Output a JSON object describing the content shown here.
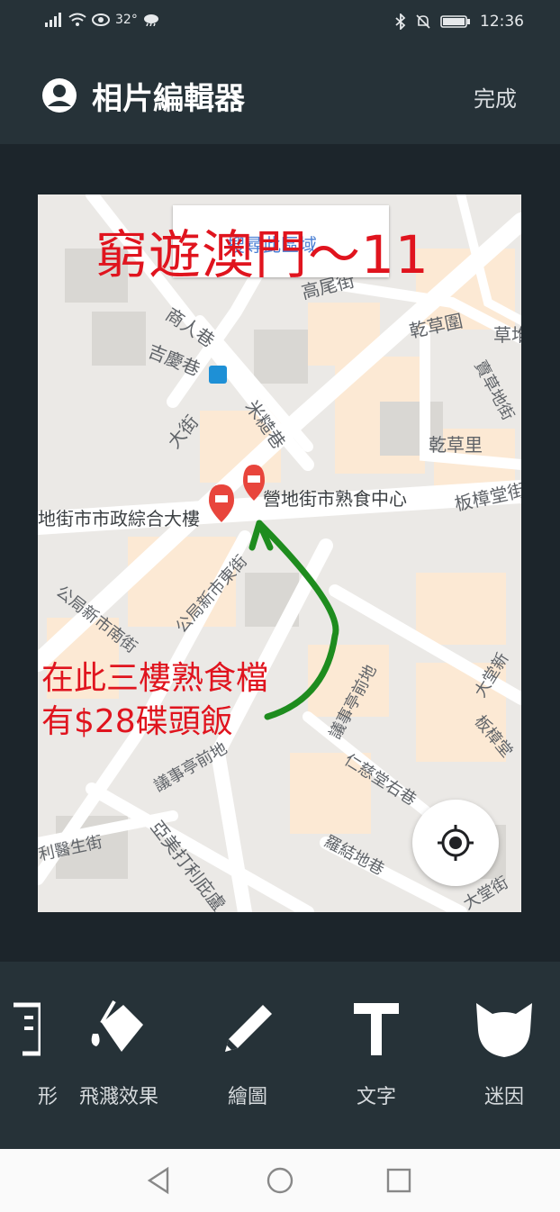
{
  "status_bar": {
    "temperature": "32°",
    "time": "12:36"
  },
  "header": {
    "title": "相片編輯器",
    "done_label": "完成"
  },
  "photo": {
    "headline": "窮遊澳門～11",
    "search_area_label": "搜尋此區域",
    "annotation_line1": "在此三樓熟食檔",
    "annotation_line2": "有$28碟頭飯",
    "annotation_color": "#e0141e",
    "arrow_color": "#1e8c1e",
    "map_labels": {
      "street_1": "高尾街",
      "street_2": "商人巷",
      "street_3": "吉慶巷",
      "street_4": "大街",
      "street_5": "米糙巷",
      "street_6": "乾草圍",
      "street_7": "乾草里",
      "street_8": "草堆",
      "street_9": "賣草地街",
      "street_10": "板樟堂街",
      "street_11": "公局新市南街",
      "street_12": "公局新市東街",
      "street_13": "議事亭前地",
      "street_14": "議事亭前地",
      "street_15": "仁慈堂右巷",
      "street_16": "羅結地巷",
      "street_17": "大堂新",
      "street_18": "板樟堂",
      "street_19": "利醫生街",
      "street_20": "亞美打利庇盧",
      "street_21": "大堂街",
      "poi_1": "營地街市熟食中心",
      "poi_2": "地街市市政綜合大樓"
    }
  },
  "tools": [
    {
      "name": "partial",
      "label": "形"
    },
    {
      "name": "splash",
      "label": "飛濺效果"
    },
    {
      "name": "draw",
      "label": "繪圖"
    },
    {
      "name": "text",
      "label": "文字"
    },
    {
      "name": "meme",
      "label": "迷因"
    }
  ],
  "icons": {
    "account": "account-circle-icon",
    "locate": "my-location-icon",
    "splash": "paint-bucket-icon",
    "draw": "pencil-icon",
    "text": "text-t-icon",
    "meme": "cat-face-icon",
    "nav_back": "triangle-back-icon",
    "nav_home": "circle-home-icon",
    "nav_recent": "square-recent-icon"
  }
}
